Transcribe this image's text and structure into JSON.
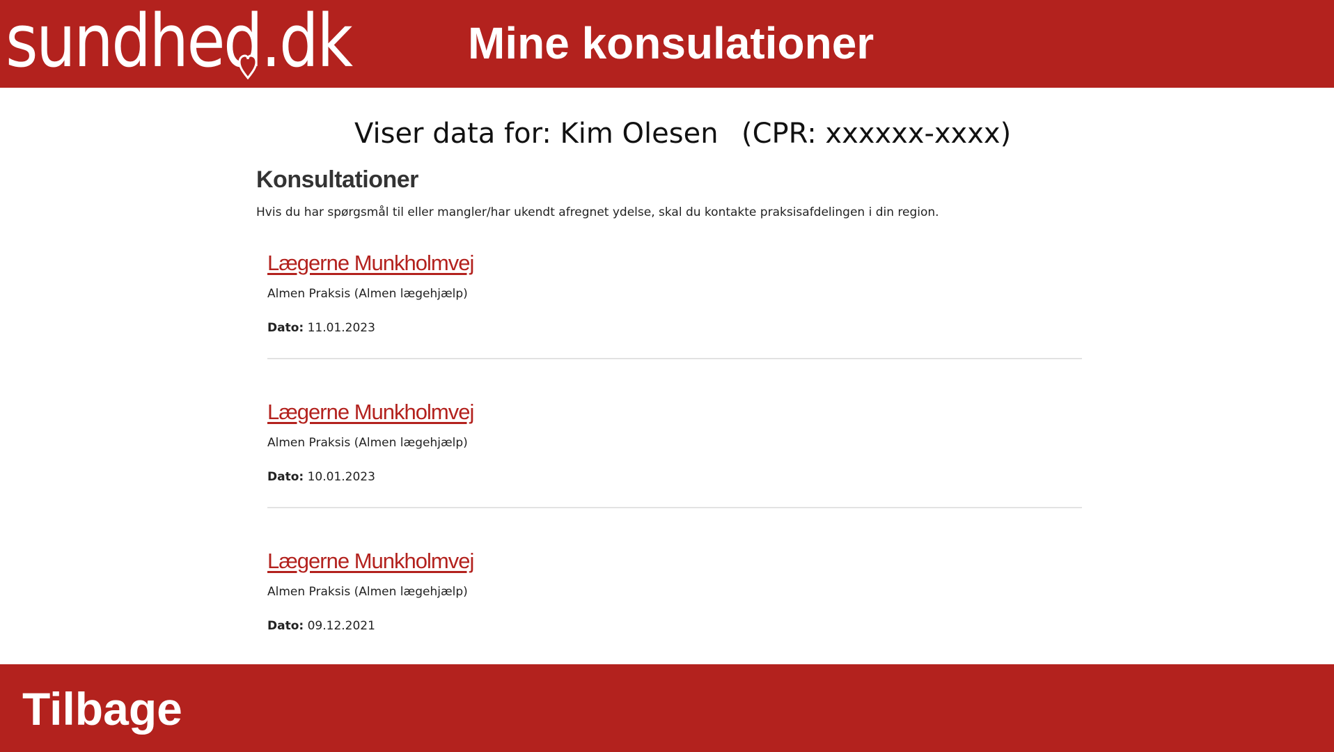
{
  "header": {
    "logo_text": "sundhed.dk",
    "title": "Mine konsulationer"
  },
  "viewer": {
    "name_line": "Viser data for: Kim Olesen",
    "cpr_line": "(CPR: xxxxxx-xxxx)"
  },
  "section": {
    "title": "Konsultationer",
    "description": "Hvis du har spørgsmål til eller mangler/har ukendt afregnet ydelse, skal du kontakte praksisafdelingen i din region."
  },
  "consultations": [
    {
      "clinic": "Lægerne Munkholmvej",
      "type": "Almen Praksis (Almen lægehjælp)",
      "date_label": "Dato:",
      "date": "11.01.2023"
    },
    {
      "clinic": "Lægerne Munkholmvej",
      "type": "Almen Praksis (Almen lægehjælp)",
      "date_label": "Dato:",
      "date": "10.01.2023"
    },
    {
      "clinic": "Lægerne Munkholmvej",
      "type": "Almen Praksis (Almen lægehjælp)",
      "date_label": "Dato:",
      "date": "09.12.2021"
    }
  ],
  "footer": {
    "back_label": "Tilbage"
  },
  "colors": {
    "brand_red": "#b3221e",
    "divider": "#e2e2e2"
  }
}
